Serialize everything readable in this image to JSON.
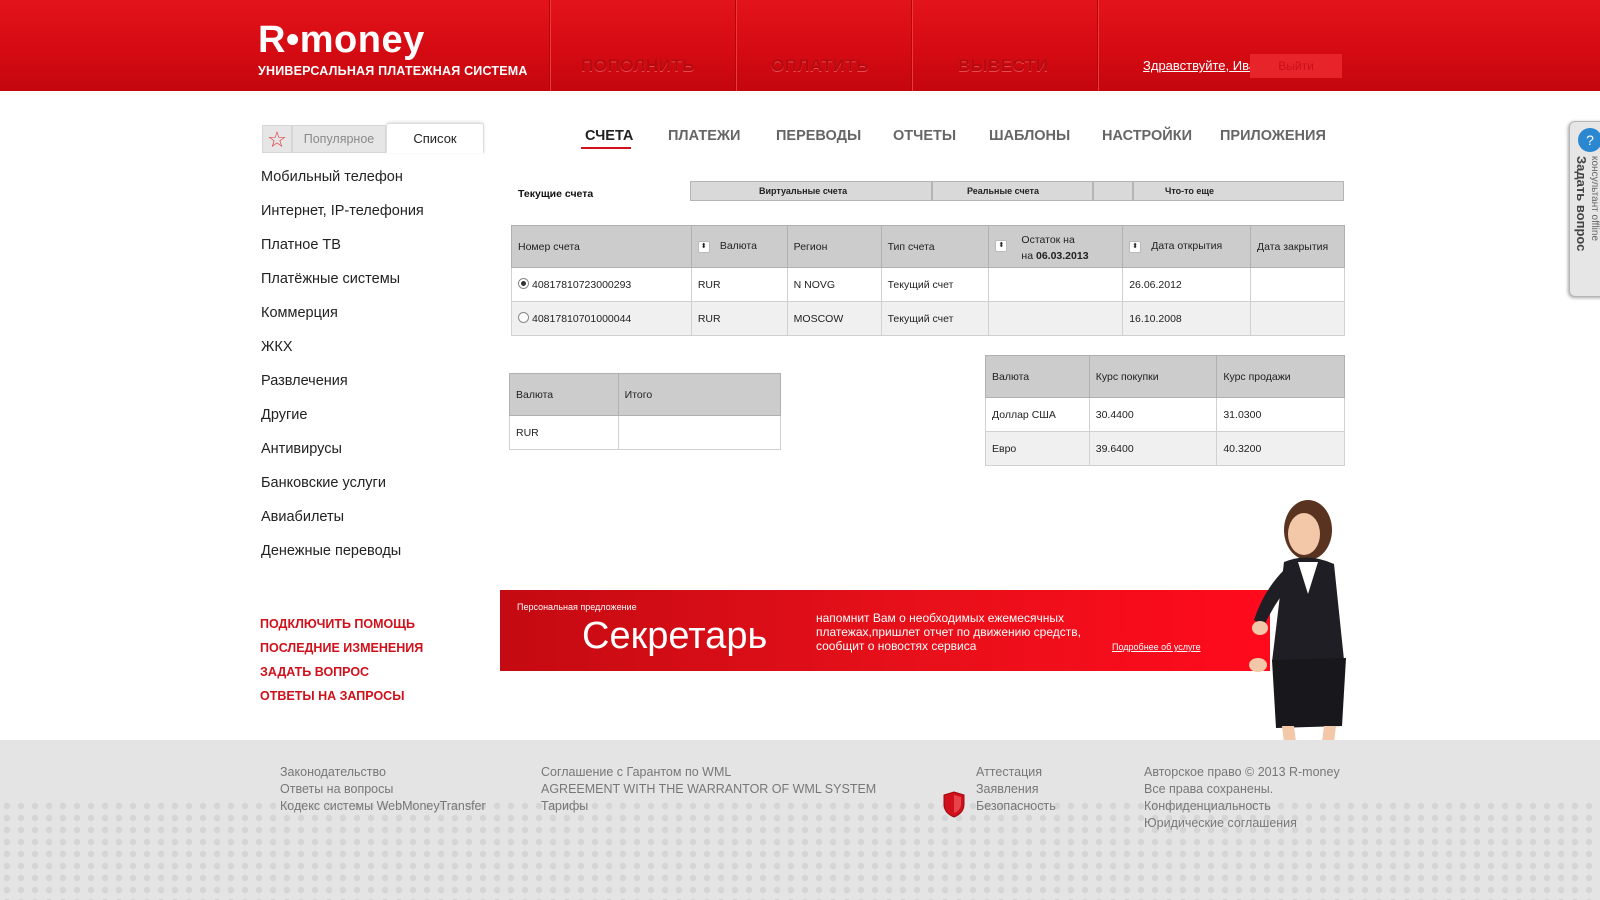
{
  "header": {
    "logo": "R•money",
    "logo_sub": "УНИВЕРСАЛЬНАЯ ПЛАТЕЖНАЯ СИСТЕМА",
    "nav": [
      "ПОПОЛНИТЬ",
      "ОПЛАТИТЬ",
      "ВЫВЕСТИ"
    ],
    "greeting": "Здравствуйте, Иван",
    "logout": "Выйти"
  },
  "sidebar": {
    "tabs": {
      "popular": "Популярное",
      "list": "Список"
    },
    "categories": [
      "Мобильный телефон",
      "Интернет, IP-телефония",
      "Платное ТВ",
      "Платёжные системы",
      "Коммерция",
      "ЖКХ",
      "Развлечения",
      "Другие",
      "Антивирусы",
      "Банковские услуги",
      "Авиабилеты",
      "Денежные переводы"
    ],
    "help_links": [
      "ПОДКЛЮЧИТЬ ПОМОЩЬ",
      "ПОСЛЕДНИЕ ИЗМЕНЕНИЯ",
      "ЗАДАТЬ ВОПРОС",
      "ОТВЕТЫ НА ЗАПРОСЫ"
    ]
  },
  "main_nav": [
    "СЧЕТА",
    "ПЛАТЕЖИ",
    "ПЕРЕВОДЫ",
    "ОТЧЕТЫ",
    "ШАБЛОНЫ",
    "НАСТРОЙКИ",
    "ПРИЛОЖЕНИЯ"
  ],
  "subtabs": {
    "current": "Текущие счета",
    "items": [
      "Виртуальные счета",
      "Реальные счета",
      "",
      "Что-то еще"
    ]
  },
  "accounts_table": {
    "headers": [
      "Номер счета",
      "Валюта",
      "Регион",
      "Тип счета",
      "Остаток на",
      "Дата открытия",
      "Дата закрытия"
    ],
    "balance_date_prefix": "на",
    "balance_date": "06.03.2013",
    "rows": [
      {
        "number": "40817810723000293",
        "currency": "RUR",
        "region": "N NOVG",
        "type": "Текущий счет",
        "balance": "",
        "opened": "26.06.2012",
        "closed": "",
        "selected": true
      },
      {
        "number": "40817810701000044",
        "currency": "RUR",
        "region": "MOSCOW",
        "type": "Текущий счет",
        "balance": "",
        "opened": "16.10.2008",
        "closed": "",
        "selected": false
      }
    ]
  },
  "totals_table": {
    "headers": [
      "Валюта",
      "Итого"
    ],
    "rows": [
      {
        "currency": "RUR",
        "total": ""
      }
    ]
  },
  "rates_table": {
    "headers": [
      "Валюта",
      "Курс покупки",
      "Курс продажи"
    ],
    "rows": [
      {
        "currency": "Доллар США",
        "buy": "30.4400",
        "sell": "31.0300"
      },
      {
        "currency": "Евро",
        "buy": "39.6400",
        "sell": "40.3200"
      }
    ]
  },
  "banner": {
    "small": "Персональная предложение",
    "title": "Секретарь",
    "text": "напомнит Вам о необходимых ежемесячных платежах,пришлет отчет по движению средств, сообщит о новостях сервиса",
    "link": "Подробнее об услуге"
  },
  "ask_widget": {
    "title": "Задать вопрос",
    "status": "консультант offline"
  },
  "footer": {
    "col1": [
      "Законодательство",
      "Ответы на вопросы",
      "Кодекс системы WebMoneyTransfer"
    ],
    "col2": [
      "Соглашение с Гарантом по WML",
      "AGREEMENT WITH THE WARRANTOR OF WML SYSTEM",
      "Тарифы"
    ],
    "col3": [
      "Аттестация",
      "Заявления",
      "Безопасность"
    ],
    "col4": [
      "Авторское право © 2013 R-money",
      "Все права сохранены.",
      "Конфиденциальность",
      "Юридические соглашения"
    ]
  },
  "colors": {
    "brand_red": "#d40a12",
    "link_red": "#d0101a",
    "table_header": "#cccccc"
  }
}
